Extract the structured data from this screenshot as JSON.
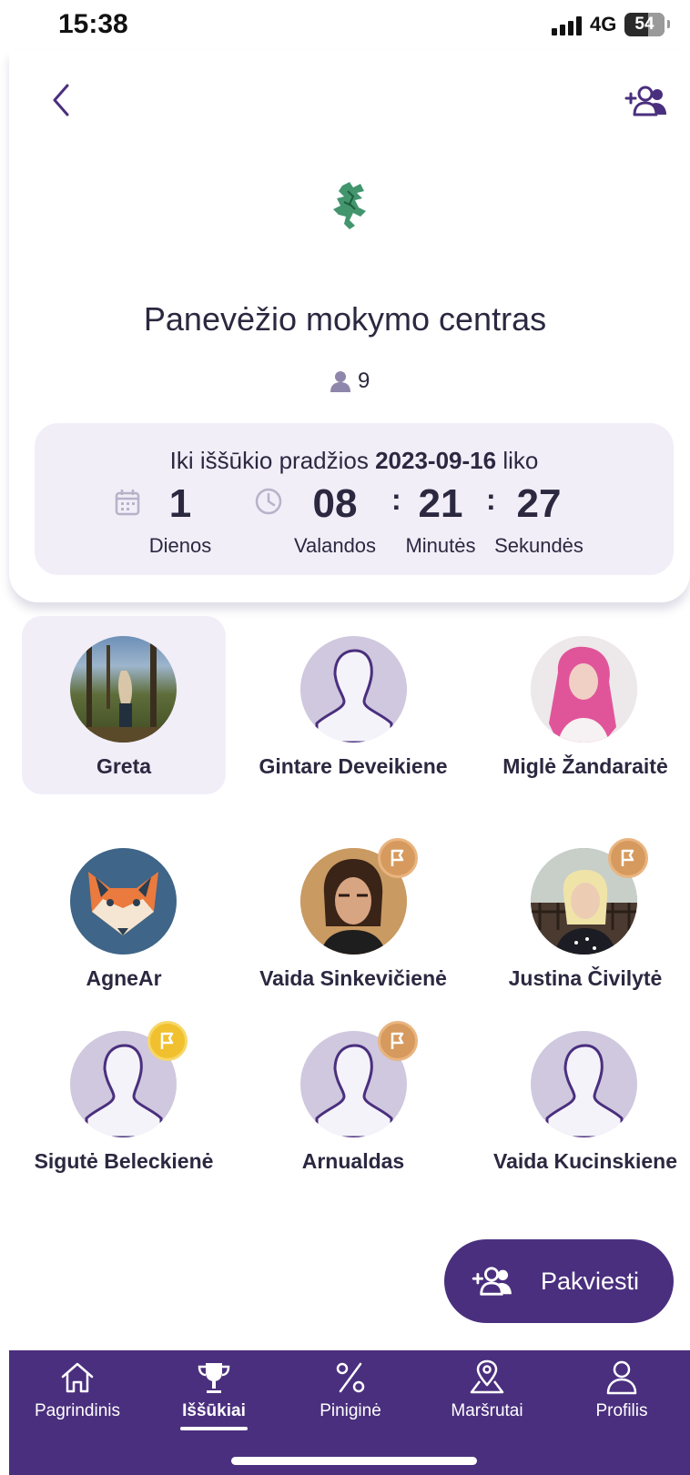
{
  "status_bar": {
    "time": "15:38",
    "network": "4G",
    "battery": "54"
  },
  "header": {
    "title": "Panevėžio mokymo centras",
    "member_count": "9"
  },
  "countdown": {
    "caption_prefix": "Iki iššūkio pradžios",
    "start_date": "2023-09-16",
    "caption_suffix": "liko",
    "days": "1",
    "hours": "08",
    "minutes": "21",
    "seconds": "27",
    "days_label": "Dienos",
    "hours_label": "Valandos",
    "minutes_label": "Minutės",
    "seconds_label": "Sekundės",
    "colon": ":"
  },
  "participants": [
    {
      "name": "Greta",
      "avatar": "photo-forest",
      "medal": "none",
      "selected": true
    },
    {
      "name": "Gintare Deveikiene",
      "avatar": "default-silhouette",
      "medal": "none"
    },
    {
      "name": "Miglė Žandaraitė",
      "avatar": "photo-pink-hair",
      "medal": "none"
    },
    {
      "name": "AgneAr",
      "avatar": "fox-icon",
      "medal": "none"
    },
    {
      "name": "Vaida Sinkevičienė",
      "avatar": "photo-woman-glasses",
      "medal": "bronze"
    },
    {
      "name": "Justina Čivilytė",
      "avatar": "photo-blonde",
      "medal": "bronze"
    },
    {
      "name": "Sigutė Beleckienė",
      "avatar": "default-silhouette",
      "medal": "gold"
    },
    {
      "name": "Arnualdas",
      "avatar": "default-silhouette",
      "medal": "bronze"
    },
    {
      "name": "Vaida Kucinskiene",
      "avatar": "default-silhouette",
      "medal": "none"
    }
  ],
  "invite_button": {
    "label": "Pakviesti",
    "icon": "add-users-icon"
  },
  "bottom_nav": [
    {
      "label": "Pagrindinis",
      "icon": "home-icon"
    },
    {
      "label": "Iššūkiai",
      "icon": "trophy-icon",
      "active": true
    },
    {
      "label": "Piniginė",
      "icon": "percent-icon"
    },
    {
      "label": "Maršrutai",
      "icon": "map-pin-icon"
    },
    {
      "label": "Profilis",
      "icon": "user-icon"
    }
  ],
  "colors": {
    "primary": "#4a2f7e",
    "accent_purple": "#5a3c91",
    "card_tint": "#f1eef8",
    "avatar_placeholder": "#cfc8de",
    "bronze_medal": "#d69a5e",
    "gold_medal": "#f1c02e"
  }
}
